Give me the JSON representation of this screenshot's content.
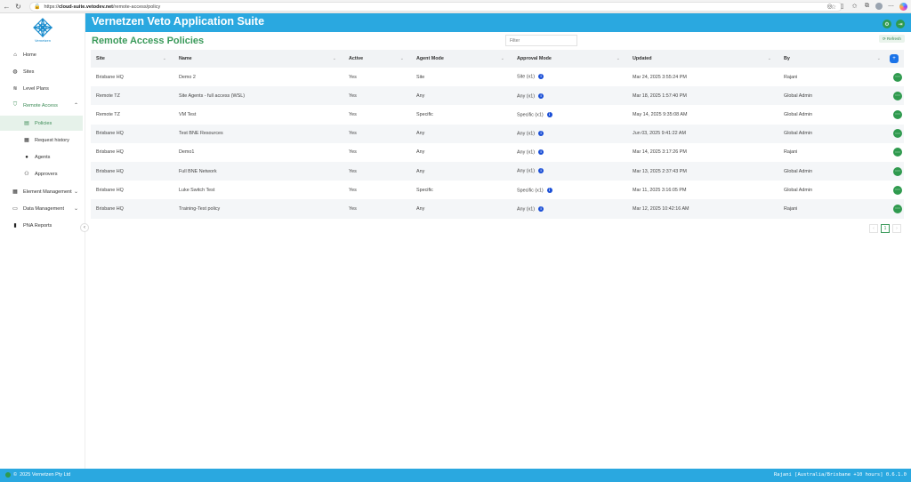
{
  "browser": {
    "url_host": "cloud-suite.vetodev.net",
    "url_path": "/remote-access/policy",
    "url_scheme": "https://"
  },
  "app": {
    "title": "Vernetzen Veto Application Suite",
    "logo_text": "Vernetzen"
  },
  "sidebar": {
    "items": [
      {
        "label": "Home",
        "icon": "home-icon"
      },
      {
        "label": "Sites",
        "icon": "globe-icon"
      },
      {
        "label": "Level Plans",
        "icon": "layers-icon"
      },
      {
        "label": "Remote Access",
        "icon": "shield-icon"
      },
      {
        "label": "Policies",
        "icon": "policy-icon"
      },
      {
        "label": "Request history",
        "icon": "document-icon"
      },
      {
        "label": "Agents",
        "icon": "user-icon"
      },
      {
        "label": "Approvers",
        "icon": "users-icon"
      },
      {
        "label": "Element Management",
        "icon": "grid-icon"
      },
      {
        "label": "Data Management",
        "icon": "database-icon"
      },
      {
        "label": "PNA Reports",
        "icon": "report-icon"
      }
    ]
  },
  "page": {
    "title": "Remote Access Policies",
    "filter_placeholder": "Filter",
    "refresh_label": "Refresh"
  },
  "table": {
    "columns": [
      "Site",
      "Name",
      "Active",
      "Agent Mode",
      "Approval Mode",
      "Updated",
      "By"
    ],
    "rows": [
      {
        "site": "Brisbane HQ",
        "name": "Demo 2",
        "active": "Yes",
        "agent_mode": "Site",
        "approval": "Site (x1)",
        "updated": "Mar 24, 2025 3:55:24 PM",
        "by": "Rajani"
      },
      {
        "site": "Remote TZ",
        "name": "Site Agents - full access (WSL)",
        "active": "Yes",
        "agent_mode": "Any",
        "approval": "Any (x1)",
        "updated": "Mar 18, 2025 1:57:40 PM",
        "by": "Global Admin"
      },
      {
        "site": "Remote TZ",
        "name": "VM Test",
        "active": "Yes",
        "agent_mode": "Specific",
        "approval": "Specific (x1)",
        "updated": "May 14, 2025 9:35:08 AM",
        "by": "Global Admin"
      },
      {
        "site": "Brisbane HQ",
        "name": "Test BNE Resources",
        "active": "Yes",
        "agent_mode": "Any",
        "approval": "Any (x1)",
        "updated": "Jun 03, 2025 9:41:22 AM",
        "by": "Global Admin"
      },
      {
        "site": "Brisbane HQ",
        "name": "Demo1",
        "active": "Yes",
        "agent_mode": "Any",
        "approval": "Any (x1)",
        "updated": "Mar 14, 2025 3:17:26 PM",
        "by": "Rajani"
      },
      {
        "site": "Brisbane HQ",
        "name": "Full BNE Network",
        "active": "Yes",
        "agent_mode": "Any",
        "approval": "Any (x1)",
        "updated": "Mar 13, 2025 2:37:43 PM",
        "by": "Global Admin"
      },
      {
        "site": "Brisbane HQ",
        "name": "Luke Switch Test",
        "active": "Yes",
        "agent_mode": "Specific",
        "approval": "Specific (x1)",
        "updated": "Mar 11, 2025 3:16:05 PM",
        "by": "Global Admin"
      },
      {
        "site": "Brisbane HQ",
        "name": "Training-Test policy",
        "active": "Yes",
        "agent_mode": "Any",
        "approval": "Any (x1)",
        "updated": "Mar 12, 2025 10:42:16 AM",
        "by": "Rajani"
      }
    ]
  },
  "pagination": {
    "current_page": "1"
  },
  "footer": {
    "copyright": "2025 Vernetzen Pty Ltd",
    "status": "Rajani [Australia/Brisbane +10 hours] 0.6.1.0"
  },
  "colors": {
    "accent_blue": "#2aa8e0",
    "accent_green": "#3a9a5a",
    "button_green": "#2f9a4e",
    "info_blue": "#1b4fd6"
  }
}
